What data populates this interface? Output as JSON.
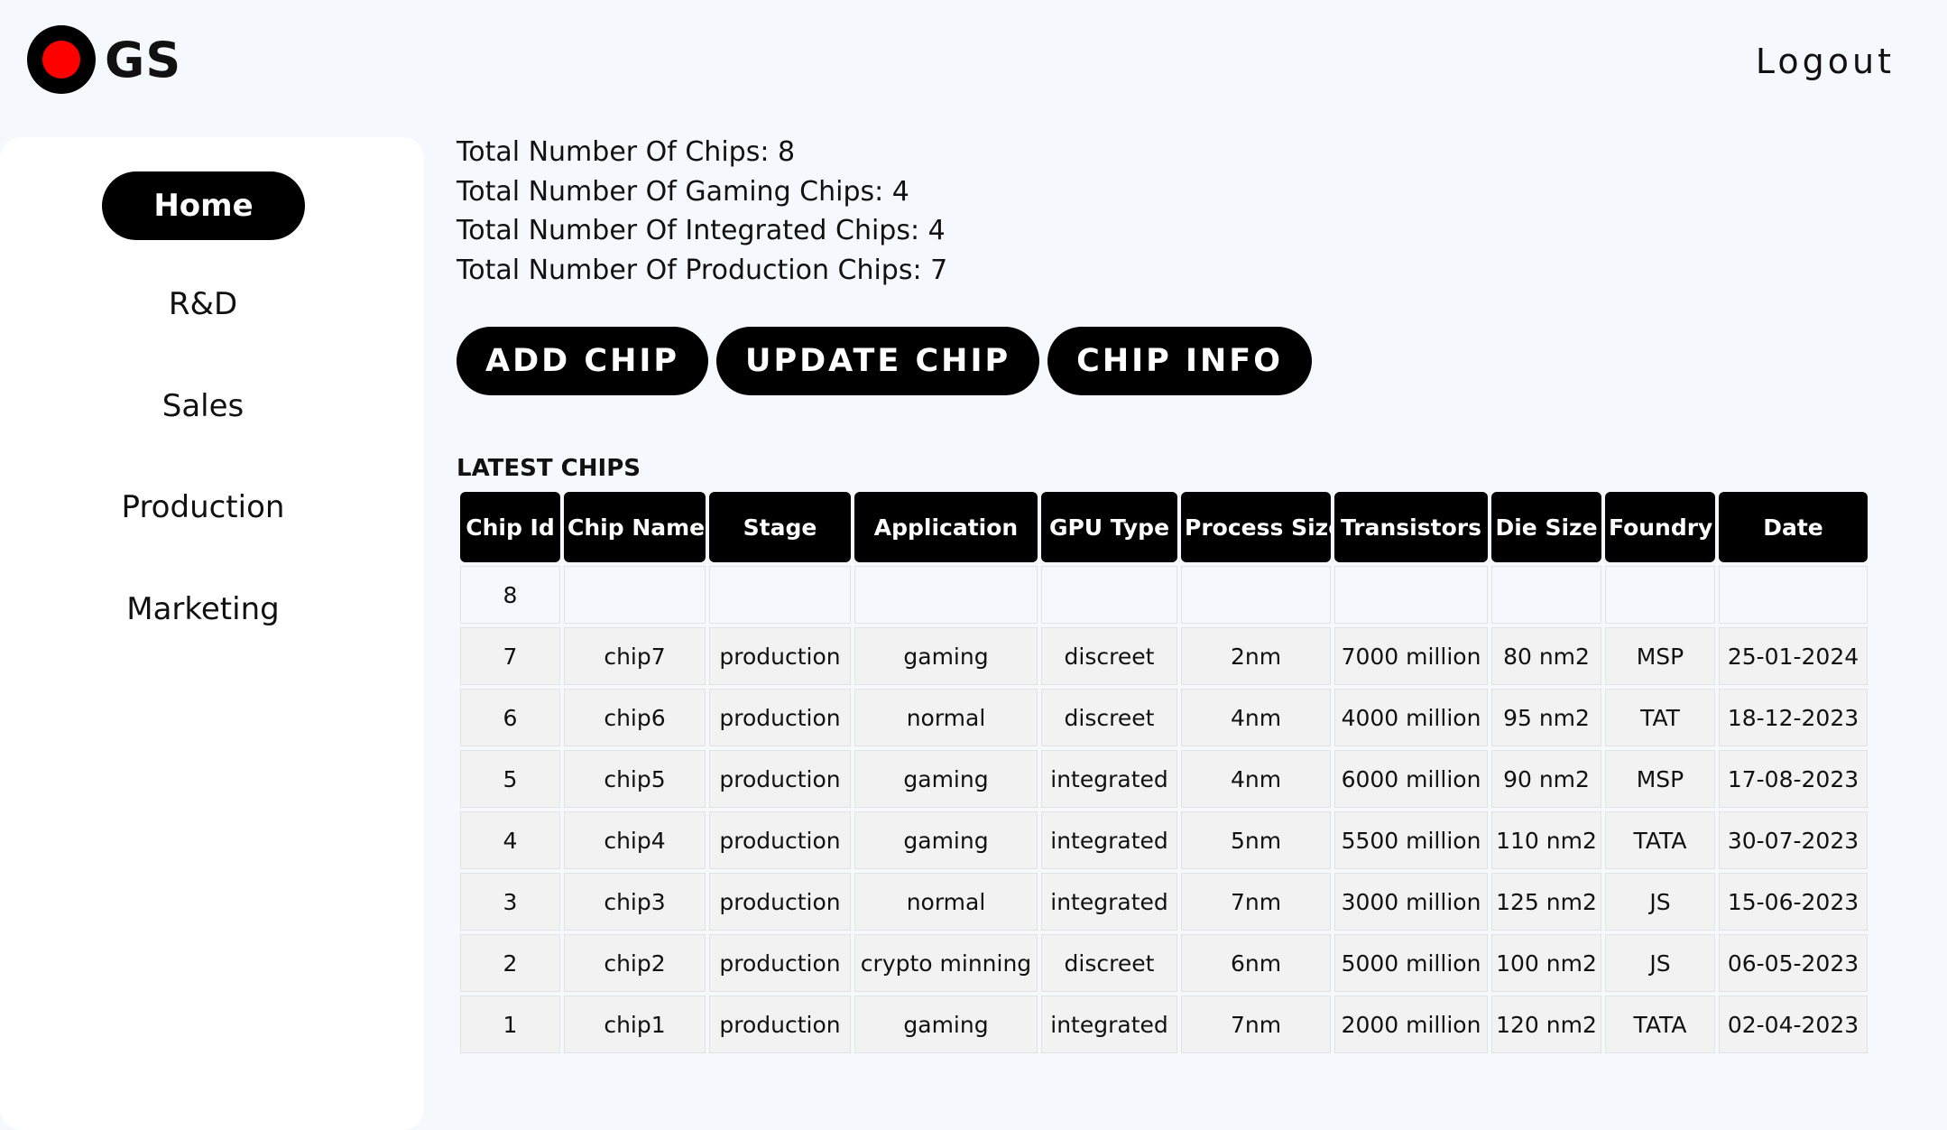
{
  "app": {
    "logo_text": "GS",
    "logout_label": "Logout"
  },
  "sidebar": {
    "items": [
      {
        "label": "Home",
        "active": true
      },
      {
        "label": "R&D",
        "active": false
      },
      {
        "label": "Sales",
        "active": false
      },
      {
        "label": "Production",
        "active": false
      },
      {
        "label": "Marketing",
        "active": false
      }
    ]
  },
  "stats": {
    "total": "Total Number Of Chips: 8",
    "gaming": "Total Number Of Gaming Chips: 4",
    "integrated": "Total Number Of Integrated Chips: 4",
    "production": "Total Number Of Production Chips: 7"
  },
  "actions": {
    "add": "ADD CHIP",
    "update": "UPDATE CHIP",
    "info": "CHIP INFO"
  },
  "table": {
    "title": "LATEST CHIPS",
    "columns": [
      "Chip Id",
      "Chip Name",
      "Stage",
      "Application",
      "GPU Type",
      "Process Size",
      "Transistors",
      "Die Size",
      "Foundry",
      "Date"
    ],
    "rows": [
      [
        "8",
        "",
        "",
        "",
        "",
        "",
        "",
        "",
        "",
        ""
      ],
      [
        "7",
        "chip7",
        "production",
        "gaming",
        "discreet",
        "2nm",
        "7000 million",
        "80 nm2",
        "MSP",
        "25-01-2024"
      ],
      [
        "6",
        "chip6",
        "production",
        "normal",
        "discreet",
        "4nm",
        "4000 million",
        "95 nm2",
        "TAT",
        "18-12-2023"
      ],
      [
        "5",
        "chip5",
        "production",
        "gaming",
        "integrated",
        "4nm",
        "6000 million",
        "90 nm2",
        "MSP",
        "17-08-2023"
      ],
      [
        "4",
        "chip4",
        "production",
        "gaming",
        "integrated",
        "5nm",
        "5500 million",
        "110 nm2",
        "TATA",
        "30-07-2023"
      ],
      [
        "3",
        "chip3",
        "production",
        "normal",
        "integrated",
        "7nm",
        "3000 million",
        "125 nm2",
        "JS",
        "15-06-2023"
      ],
      [
        "2",
        "chip2",
        "production",
        "crypto minning",
        "discreet",
        "6nm",
        "5000 million",
        "100 nm2",
        "JS",
        "06-05-2023"
      ],
      [
        "1",
        "chip1",
        "production",
        "gaming",
        "integrated",
        "7nm",
        "2000 million",
        "120 nm2",
        "TATA",
        "02-04-2023"
      ]
    ]
  },
  "colors": {
    "background": "#f5f9fd",
    "accent": "#000000",
    "logo_dot": "#ff0000"
  }
}
